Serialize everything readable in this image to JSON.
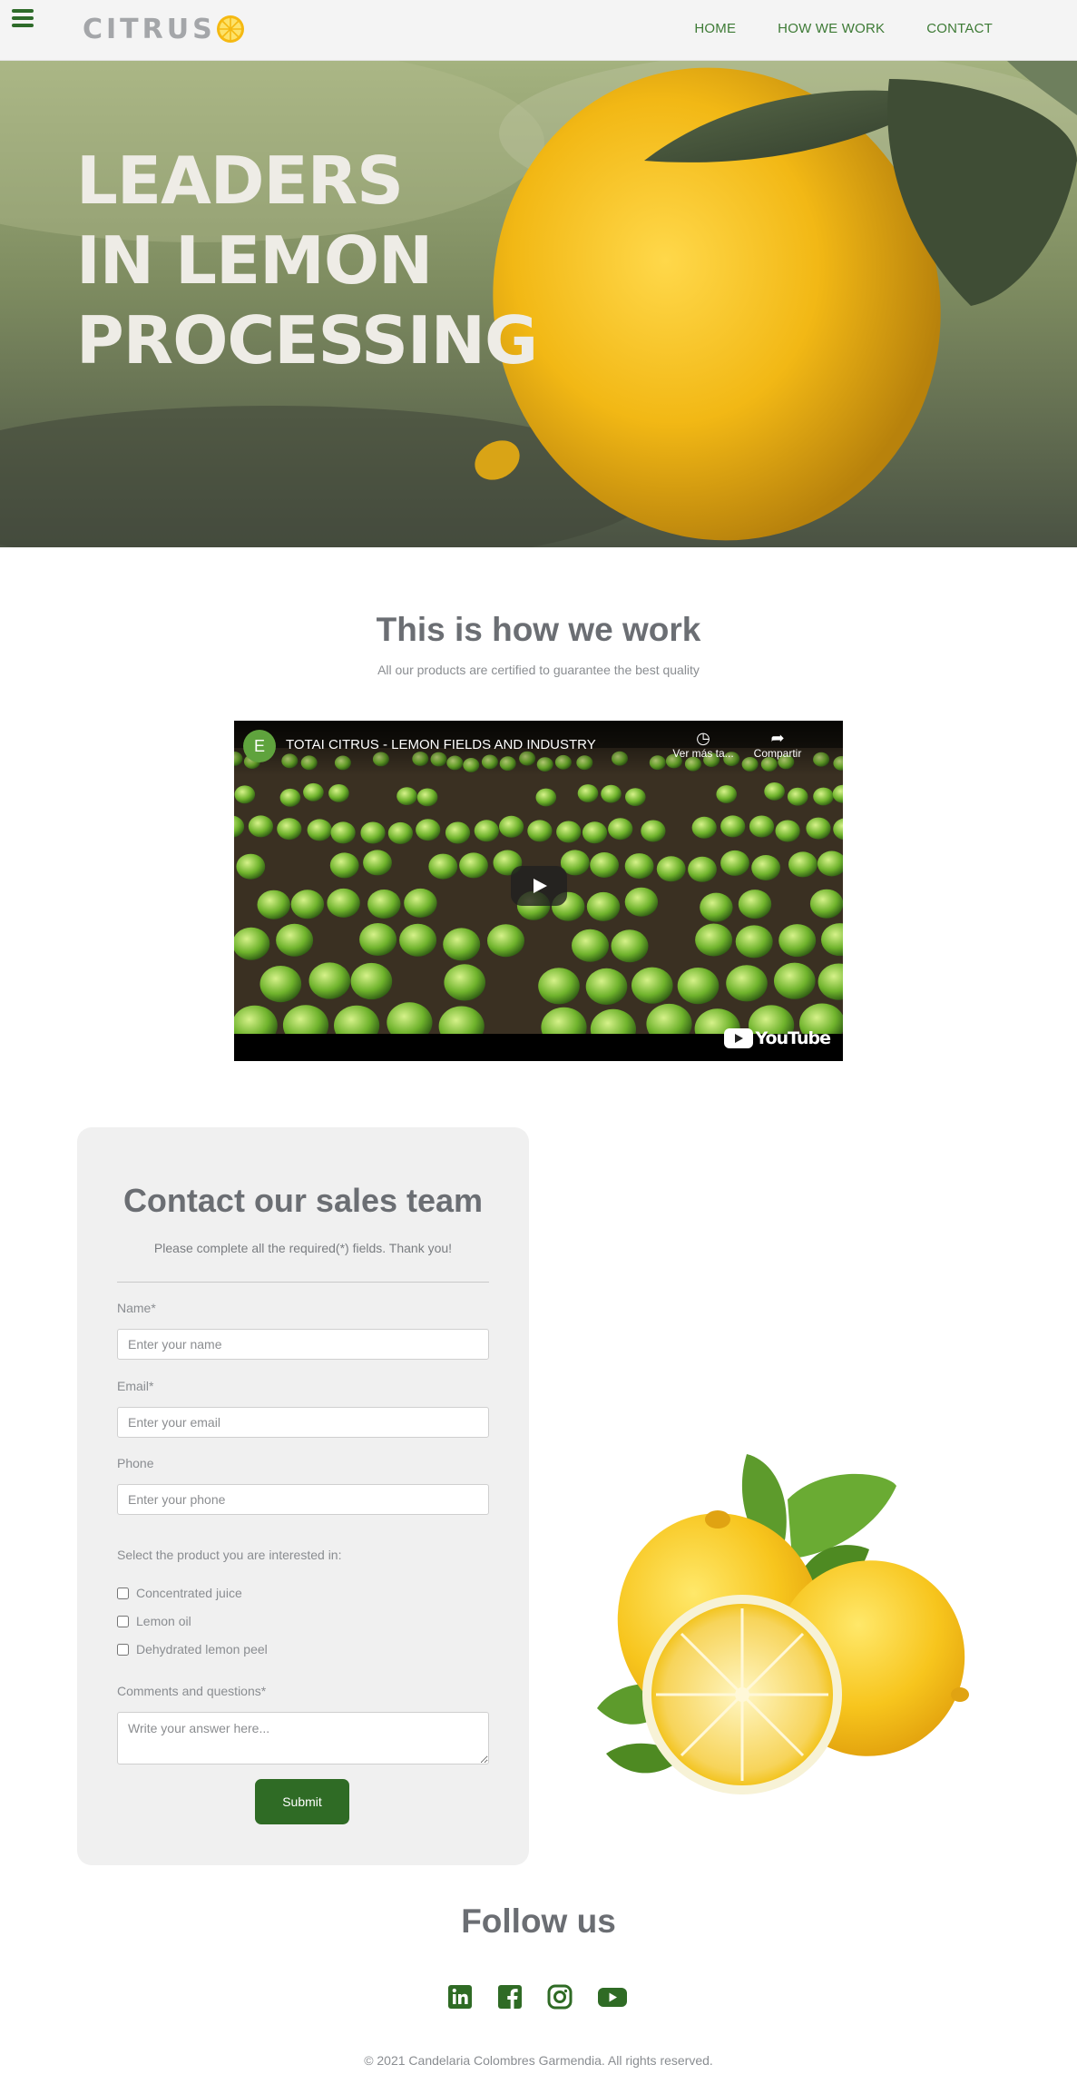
{
  "header": {
    "logo_text": "CITRUS",
    "nav": [
      "HOME",
      "HOW WE WORK",
      "CONTACT"
    ]
  },
  "hero": {
    "title_lines": [
      "LEADERS",
      "IN LEMON",
      "PROCESSING"
    ]
  },
  "work": {
    "title": "This is how we work",
    "subtitle": "All our products are certified to guarantee the best quality",
    "video": {
      "channel_initial": "E",
      "title": "TOTAI CITRUS - LEMON FIELDS AND INDUSTRY",
      "watch_later_label": "Ver más ta...",
      "share_label": "Compartir",
      "brand": "YouTube"
    }
  },
  "contact": {
    "title": "Contact our sales team",
    "subtitle": "Please complete all the required(*) fields. Thank you!",
    "name_label": "Name*",
    "name_placeholder": "Enter your name",
    "email_label": "Email*",
    "email_placeholder": "Enter your email",
    "phone_label": "Phone",
    "phone_placeholder": "Enter your phone",
    "product_prompt": "Select the product you are interested in:",
    "products": [
      "Concentrated juice",
      "Lemon oil",
      "Dehydrated lemon peel"
    ],
    "comments_label": "Comments and questions*",
    "comments_placeholder": "Write your answer here...",
    "submit_label": "Submit"
  },
  "footer": {
    "follow_title": "Follow us",
    "social_icons": [
      "linkedin-icon",
      "facebook-icon",
      "instagram-icon",
      "youtube-icon"
    ],
    "copyright": "© 2021 Candelaria Colombres Garmendia. All rights reserved."
  },
  "colors": {
    "brand_green": "#2f6b25",
    "nav_green": "#3d7a35",
    "lemon_yellow": "#f3c21b",
    "card_bg": "#f0f0f0"
  }
}
